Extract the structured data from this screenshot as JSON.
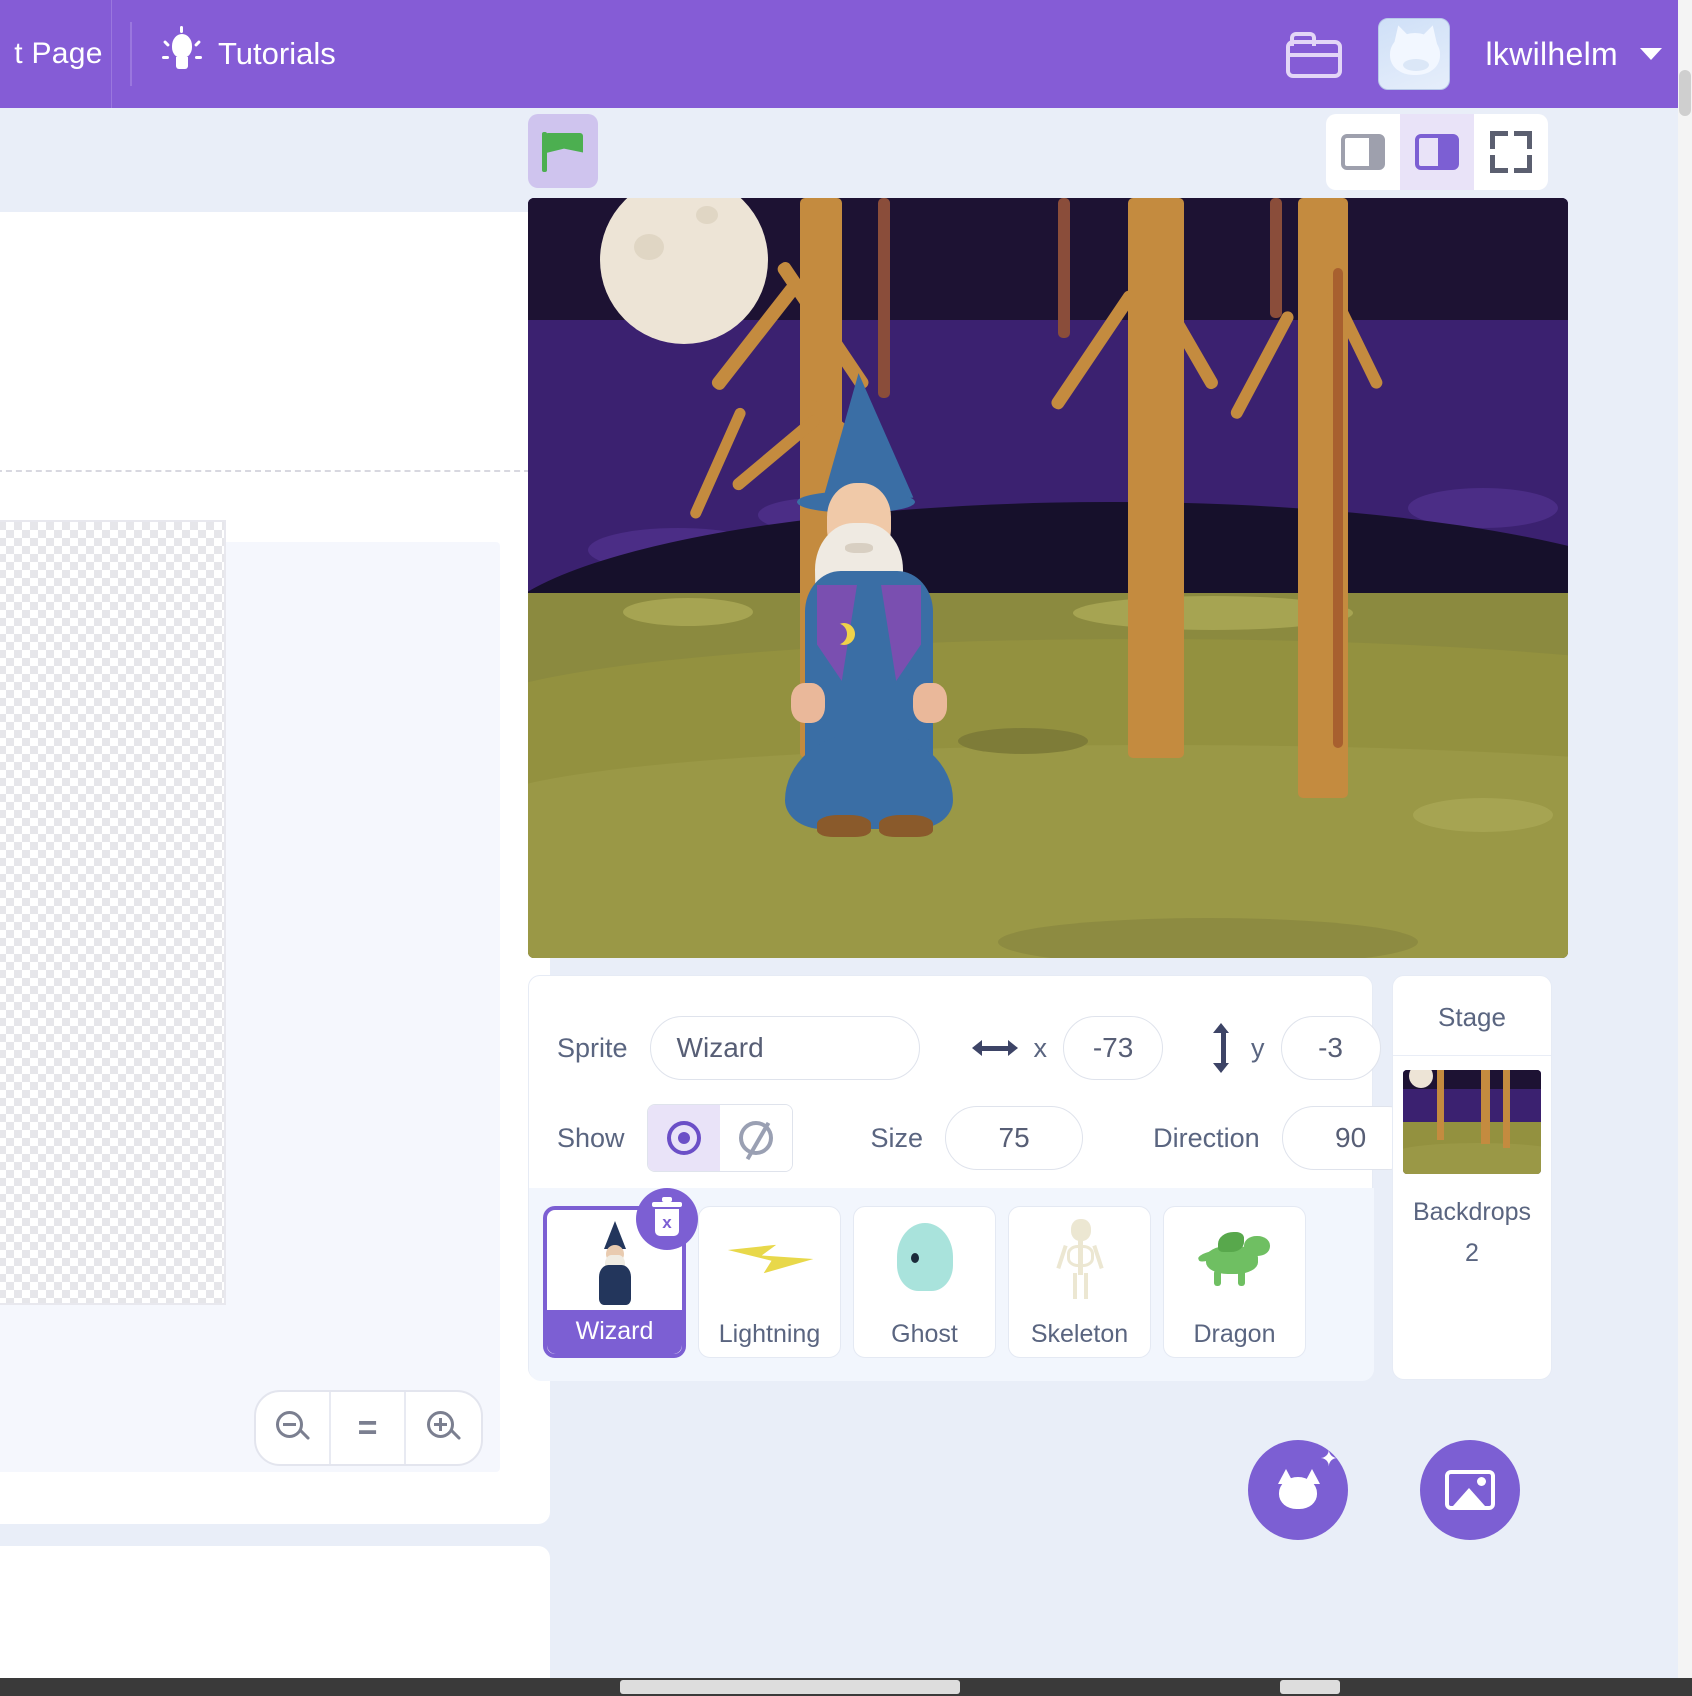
{
  "menu": {
    "page_button_label": "t Page",
    "tutorials_label": "Tutorials",
    "folder_icon": "folder-icon",
    "bulb_icon": "lightbulb-icon",
    "username": "lkwilhelm",
    "avatar_icon": "cat-avatar-icon",
    "caret_icon": "chevron-down-icon",
    "brand_color": "#855cd6"
  },
  "stage_controls": {
    "green_flag_icon": "green-flag-icon",
    "stop_icon": "stop-sign-icon",
    "small_stage_icon": "small-stage-icon",
    "large_stage_icon": "large-stage-icon",
    "fullscreen_icon": "fullscreen-icon",
    "selected_size": "large",
    "flag_color": "#4caf50",
    "stop_color": "#ec5a5a",
    "accent_color": "#7c5fd3"
  },
  "sprite_info": {
    "sprite_label": "Sprite",
    "sprite_name": "Wizard",
    "x_label": "x",
    "x_value": "-73",
    "y_label": "y",
    "y_value": "-3",
    "show_label": "Show",
    "show_state": "visible",
    "size_label": "Size",
    "size_value": "75",
    "direction_label": "Direction",
    "direction_value": "90"
  },
  "sprites": [
    {
      "name": "Wizard",
      "selected": true,
      "thumb": "wizard-thumb"
    },
    {
      "name": "Lightning",
      "selected": false,
      "thumb": "lightning-thumb"
    },
    {
      "name": "Ghost",
      "selected": false,
      "thumb": "ghost-thumb"
    },
    {
      "name": "Skeleton",
      "selected": false,
      "thumb": "skeleton-thumb"
    },
    {
      "name": "Dragon",
      "selected": false,
      "thumb": "dragon-thumb"
    }
  ],
  "delete_badge_icon": "trash-icon",
  "add_sprite_icon": "add-sprite-cat-icon",
  "stage_panel": {
    "title": "Stage",
    "backdrops_label": "Backdrops",
    "backdrops_count": "2",
    "add_backdrop_icon": "add-backdrop-image-icon"
  },
  "paint_editor": {
    "zoom_out_icon": "zoom-out-icon",
    "zoom_reset_label": "=",
    "zoom_in_icon": "zoom-in-icon"
  }
}
